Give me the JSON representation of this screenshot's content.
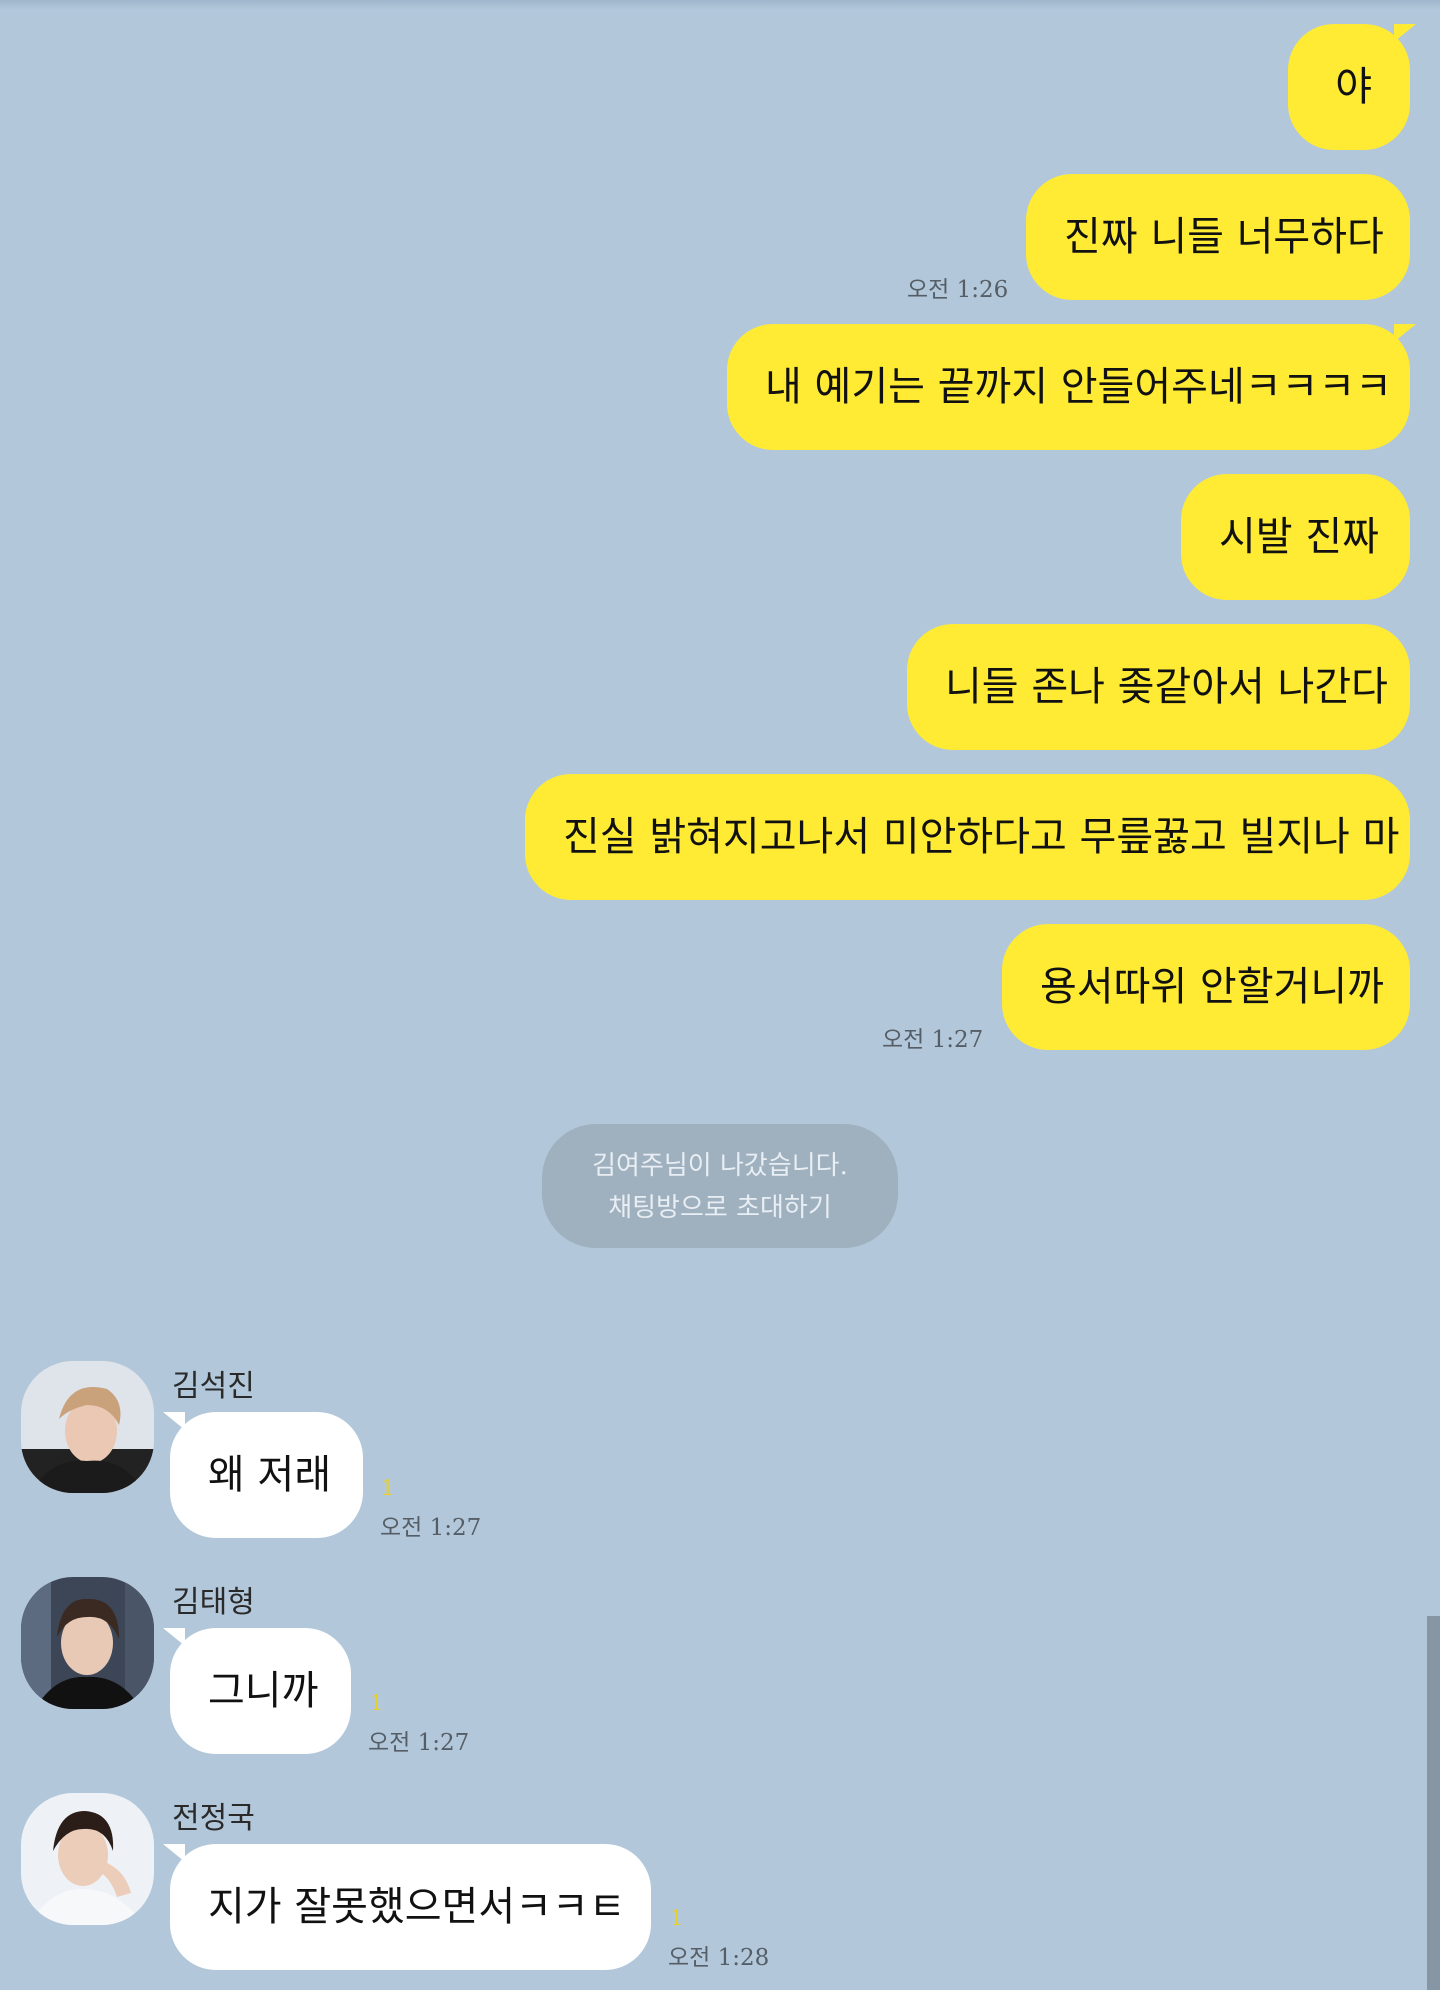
{
  "colors": {
    "background": "#b2c7da",
    "my_bubble": "#ffeb33",
    "other_bubble": "#ffffff",
    "system_notice": "#9fb0bf",
    "unread_count": "#e7cf2c"
  },
  "my_messages": [
    {
      "text": "야"
    },
    {
      "text": "진짜 니들 너무하다",
      "time": "오전 1:26"
    },
    {
      "text": "내 예기는 끝까지 안들어주네ㅋㅋㅋㅋ"
    },
    {
      "text": "시발 진짜"
    },
    {
      "text": "니들 존나 좆같아서 나간다"
    },
    {
      "text": "진실 밝혀지고나서 미안하다고 무릎꿇고 빌지나 마"
    },
    {
      "text": "용서따위 안할거니까",
      "time": "오전 1:27"
    }
  ],
  "system_notice": {
    "line1": "김여주님이 나갔습니다.",
    "line2": "채팅방으로 초대하기"
  },
  "other_messages": [
    {
      "sender": "김석진",
      "text": "왜 저래",
      "unread": "1",
      "time": "오전 1:27",
      "avatar": "profile-photo-icon"
    },
    {
      "sender": "김태형",
      "text": "그니까",
      "unread": "1",
      "time": "오전 1:27",
      "avatar": "profile-photo-icon"
    },
    {
      "sender": "전정국",
      "text": "지가 잘못했으면서ㅋㅋㅌ",
      "unread": "1",
      "time": "오전 1:28",
      "avatar": "profile-photo-icon"
    }
  ]
}
